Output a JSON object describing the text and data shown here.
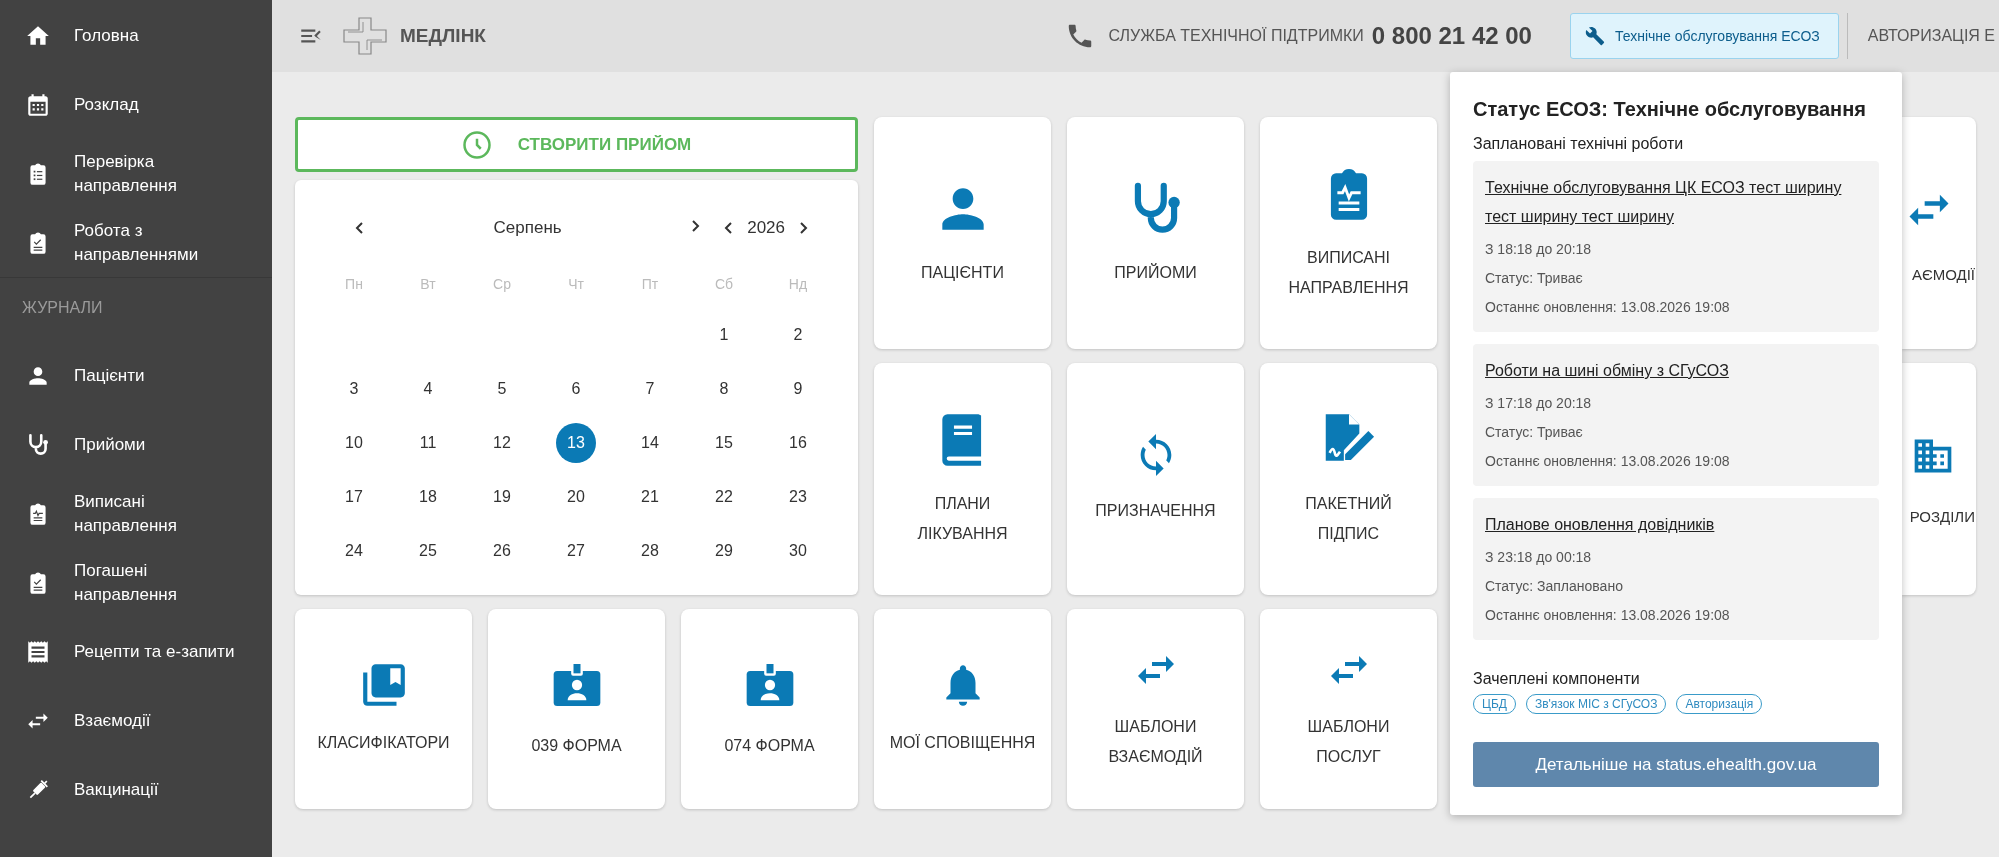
{
  "sidebar": {
    "items": [
      {
        "label": "Головна"
      },
      {
        "label": "Розклад"
      },
      {
        "label": "Перевірка направлення"
      },
      {
        "label": "Робота з направленнями"
      }
    ],
    "section_title": "ЖУРНАЛИ",
    "journal_items": [
      {
        "label": "Пацієнти"
      },
      {
        "label": "Прийоми"
      },
      {
        "label": "Виписані направлення"
      },
      {
        "label": "Погашені направлення"
      },
      {
        "label": "Рецепти та е-запити"
      },
      {
        "label": "Взаємодії"
      },
      {
        "label": "Вакцинації"
      }
    ]
  },
  "header": {
    "logo_text": "МЕДЛІНК",
    "support_label": "СЛУЖБА ТЕХНІЧНОЇ ПІДТРИМКИ",
    "support_phone": "0 800 21 42 00",
    "maintenance_button": "Технічне обслуговування ЕСОЗ",
    "auth_link": "АВТОРИЗАЦІЯ Е"
  },
  "create_button": "СТВОРИТИ ПРИЙОМ",
  "calendar": {
    "month": "Серпень",
    "year": "2026",
    "weekdays": [
      "Пн",
      "Вт",
      "Ср",
      "Чт",
      "Пт",
      "Сб",
      "Нд"
    ],
    "weeks": [
      [
        {
          "day": "1",
          "selected": false
        },
        {
          "day": "2",
          "selected": false
        }
      ],
      [
        {
          "day": "3",
          "selected": false
        },
        {
          "day": "4",
          "selected": false
        },
        {
          "day": "5",
          "selected": false
        },
        {
          "day": "6",
          "selected": false
        },
        {
          "day": "7",
          "selected": false
        },
        {
          "day": "8",
          "selected": false
        },
        {
          "day": "9",
          "selected": false
        }
      ],
      [
        {
          "day": "10",
          "selected": false
        },
        {
          "day": "11",
          "selected": false
        },
        {
          "day": "12",
          "selected": false
        },
        {
          "day": "13",
          "selected": true
        },
        {
          "day": "14",
          "selected": false
        },
        {
          "day": "15",
          "selected": false
        },
        {
          "day": "16",
          "selected": false
        }
      ],
      [
        {
          "day": "17",
          "selected": false
        },
        {
          "day": "18",
          "selected": false
        },
        {
          "day": "19",
          "selected": false
        },
        {
          "day": "20",
          "selected": false
        },
        {
          "day": "21",
          "selected": false
        },
        {
          "day": "22",
          "selected": false
        },
        {
          "day": "23",
          "selected": false
        }
      ],
      [
        {
          "day": "24",
          "selected": false
        },
        {
          "day": "25",
          "selected": false
        },
        {
          "day": "26",
          "selected": false
        },
        {
          "day": "27",
          "selected": false
        },
        {
          "day": "28",
          "selected": false
        },
        {
          "day": "29",
          "selected": false
        },
        {
          "day": "30",
          "selected": false
        }
      ]
    ]
  },
  "tiles": [
    {
      "label": "ПАЦІЄНТИ"
    },
    {
      "label": "ПРИЙОМИ"
    },
    {
      "label": "ВИПИСАНІ НАПРАВЛЕННЯ"
    },
    {
      "label": "ПЛАНИ ЛІКУВАННЯ"
    },
    {
      "label": "ПРИЗНАЧЕННЯ"
    },
    {
      "label": "ПАКЕТНИЙ ПІДПИС"
    },
    {
      "label": "КЛАСИФІКАТОРИ"
    },
    {
      "label": "039 ФОРМА"
    },
    {
      "label": "074 ФОРМА"
    },
    {
      "label": "МОЇ СПОВІЩЕННЯ"
    },
    {
      "label": "ШАБЛОНИ ВЗАЄМОДІЙ"
    },
    {
      "label": "ШАБЛОНИ ПОСЛУГ"
    }
  ],
  "partial_tiles": [
    {
      "label": "АЄМОДІЇ"
    },
    {
      "label": "РОЗДІЛИ"
    }
  ],
  "status_popup": {
    "title": "Статус ЕСОЗ: Технічне обслуговування",
    "section_title": "Заплановані технічні роботи",
    "works": [
      {
        "title": "Технічне обслуговування ЦК ЕСОЗ тест ширину тест ширину тест ширину",
        "time": "З 18:18 до 20:18",
        "status": "Статус: Триває",
        "updated": "Останнє оновлення: 13.08.2026 19:08"
      },
      {
        "title": "Роботи на шині обміну з СГуСОЗ",
        "time": "З 17:18 до 20:18",
        "status": "Статус: Триває",
        "updated": "Останнє оновлення: 13.08.2026 19:08"
      },
      {
        "title": "Планове оновлення довідників",
        "time": "З 23:18 до 00:18",
        "status": "Статус: Заплановано",
        "updated": "Останнє оновлення: 13.08.2026 19:08"
      }
    ],
    "components_title": "Зачеплені компоненти",
    "components": [
      "ЦБД",
      "Зв'язок МІС з СГуСОЗ",
      "Авторизація"
    ],
    "button": "Детальніше на status.ehealth.gov.ua"
  }
}
